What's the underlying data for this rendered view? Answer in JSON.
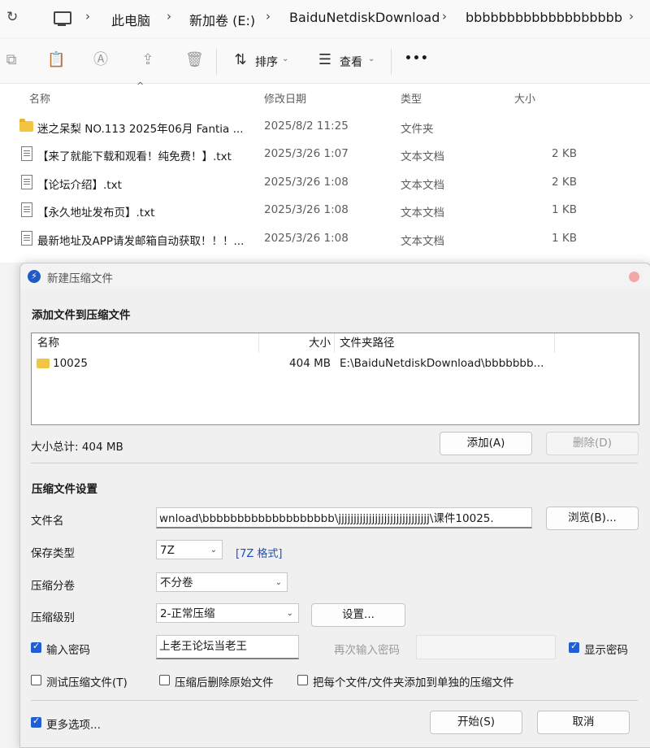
{
  "address": {
    "refresh_icon": "refresh-icon",
    "computer_icon": "computer-icon",
    "crumbs": [
      "此电脑",
      "新加卷 (E:)",
      "BaiduNetdiskDownload",
      "bbbbbbbbbbbbbbbbbbb"
    ]
  },
  "toolbar": {
    "sort_label": "排序",
    "view_label": "查看",
    "more_label": "•••"
  },
  "filelist": {
    "headers": {
      "name": "名称",
      "date": "修改日期",
      "type": "类型",
      "size": "大小"
    },
    "rows": [
      {
        "name": "迷之呆梨 NO.113 2025年06月 Fantia ...",
        "date": "2025/8/2 11:25",
        "type": "文件夹",
        "size": "",
        "icon": "folder-icon"
      },
      {
        "name": "【来了就能下载和观看！纯免费！】.txt",
        "date": "2025/3/26 1:07",
        "type": "文本文档",
        "size": "2 KB",
        "icon": "text-file-icon"
      },
      {
        "name": "【论坛介绍】.txt",
        "date": "2025/3/26 1:08",
        "type": "文本文档",
        "size": "2 KB",
        "icon": "text-file-icon"
      },
      {
        "name": "【永久地址发布页】.txt",
        "date": "2025/3/26 1:08",
        "type": "文本文档",
        "size": "1 KB",
        "icon": "text-file-icon"
      },
      {
        "name": "最新地址及APP请发邮箱自动获取！！！...",
        "date": "2025/3/26 1:08",
        "type": "文本文档",
        "size": "1 KB",
        "icon": "text-file-icon"
      }
    ]
  },
  "dialog": {
    "title": "新建压缩文件",
    "add_section": "添加文件到压缩文件",
    "list_headers": {
      "name": "名称",
      "size": "大小",
      "path": "文件夹路径"
    },
    "list_rows": [
      {
        "name": "10025",
        "size": "404 MB",
        "path": "E:\\BaiduNetdiskDownload\\bbbbbbb..."
      }
    ],
    "total_size": "大小总计: 404 MB",
    "add_button": "添加(A)",
    "delete_button": "删除(D)",
    "settings_section": "压缩文件设置",
    "filename_label": "文件名",
    "filename_value": "wnload\\bbbbbbbbbbbbbbbbbbb\\jjjjjjjjjjjjjjjjjjjjjjjjjjjjjj\\课件10025.",
    "browse_button": "浏览(B)...",
    "save_type_label": "保存类型",
    "save_type_value": "7Z",
    "format_link": "[7Z 格式]",
    "split_label": "压缩分卷",
    "split_value": "不分卷",
    "level_label": "压缩级别",
    "level_value": "2-正常压缩",
    "settings_button": "设置...",
    "password_label": "输入密码",
    "password_checked": true,
    "password_value": "上老王论坛当老王",
    "password_again_label": "再次输入密码",
    "show_password_label": "显示密码",
    "show_password_checked": true,
    "test_label": "测试压缩文件(T)",
    "delete_after_label": "压缩后删除原始文件",
    "separate_label": "把每个文件/文件夹添加到单独的压缩文件",
    "more_options_label": "更多选项...",
    "more_options_checked": true,
    "start_button": "开始(S)",
    "cancel_button": "取消"
  }
}
